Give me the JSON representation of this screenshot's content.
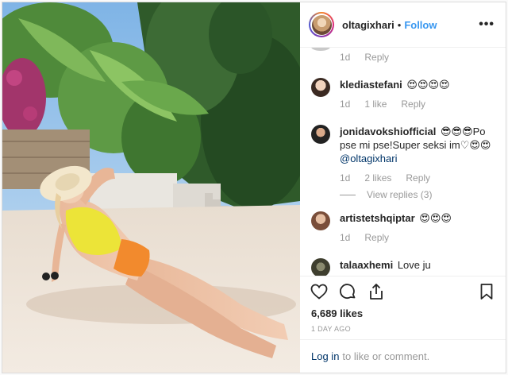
{
  "post": {
    "username": "oltagixhari",
    "follow_label": "Follow",
    "dot": "•",
    "more_label": "•••"
  },
  "comments": [
    {
      "meta_time": "1d",
      "reply_label": "Reply"
    },
    {
      "user": "klediastefani",
      "text": "😍😍😍😍",
      "time": "1d",
      "likes": "1 like",
      "reply_label": "Reply"
    },
    {
      "user": "jonidavokshiofficial",
      "text": "😎😎😎Po pse mi pse!Super seksi im♡😍😍",
      "mention": "@oltagixhari",
      "time": "1d",
      "likes": "2 likes",
      "reply_label": "Reply"
    },
    {
      "user": "artistetshqiptar",
      "text": "😍😍😍",
      "time": "1d",
      "reply_label": "Reply"
    },
    {
      "user": "talaaxhemi",
      "text": "Love ju"
    }
  ],
  "view_replies": "View replies (3)",
  "likes_count": "6,689 likes",
  "posted_ago": "1 DAY AGO",
  "login": {
    "link": "Log in",
    "rest": "to like or comment."
  },
  "icons": [
    "heart-icon",
    "comment-icon",
    "share-icon",
    "bookmark-icon"
  ]
}
